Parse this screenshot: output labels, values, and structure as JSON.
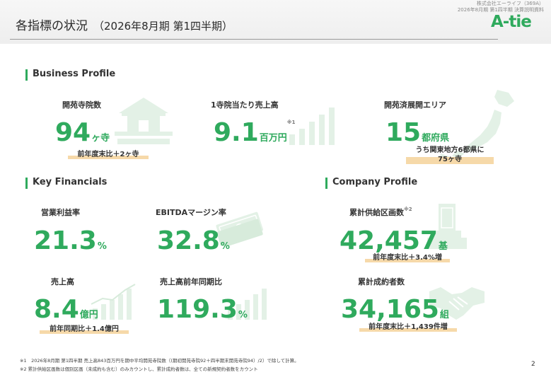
{
  "header": {
    "title": "各指標の状況",
    "subtitle": "（2026年8月期 第1四半期）",
    "company_name": "株式会社エーライフ（369A）",
    "doc_name": "2026年8月期 第1四半期 決算説明資料",
    "logo_text": "A-tie"
  },
  "business_profile": {
    "heading": "Business Profile",
    "temples": {
      "label": "開苑寺院数",
      "value": "94",
      "unit": "ヶ寺",
      "note": "前年度末比＋2ヶ寺"
    },
    "sales_per_temple": {
      "label": "1寺院当たり売上高",
      "value": "9.1",
      "unit": "百万円",
      "sup": "※1"
    },
    "area": {
      "label": "開苑済展開エリア",
      "value": "15",
      "unit": "都府県",
      "note_line1": "うち関東地方6都県に",
      "note_line2": "75ヶ寺"
    }
  },
  "key_financials": {
    "heading": "Key Financials",
    "operating_margin": {
      "label": "営業利益率",
      "value": "21.3",
      "unit": "%"
    },
    "ebitda_margin": {
      "label": "EBITDAマージン率",
      "value": "32.8",
      "unit": "%"
    },
    "revenue": {
      "label": "売上高",
      "value": "8.4",
      "unit": "億円",
      "note": "前年同期比＋1.4億円"
    },
    "revenue_yoy": {
      "label": "売上高前年同期比",
      "value": "119.3",
      "unit": "%"
    }
  },
  "company_profile": {
    "heading": "Company Profile",
    "plots_supplied": {
      "label": "累計供給区画数",
      "sup": "※2",
      "value": "42,457",
      "unit": "基",
      "note": "前年度末比＋3.4%増"
    },
    "contracts": {
      "label": "累計成約者数",
      "value": "34,165",
      "unit": "組",
      "note": "前年度末比＋1,439件増"
    }
  },
  "footnotes": {
    "note1": "※1　2026年8月期 第1四半期 売上高843百万円を期中平均開苑寺院数（(期初開苑寺院92＋四半期末開苑寺院94）/2）で除して計算。",
    "note2": "※2 累計供給区画数は個別区画（未成約も含む）のみカウントし、累計成約者数は、全ての新規契約者数をカウント"
  },
  "page_number": "2",
  "colors": {
    "accent": "#2faa5d",
    "highlight": "#f6d9a9",
    "decor": "#e3f1e6"
  }
}
